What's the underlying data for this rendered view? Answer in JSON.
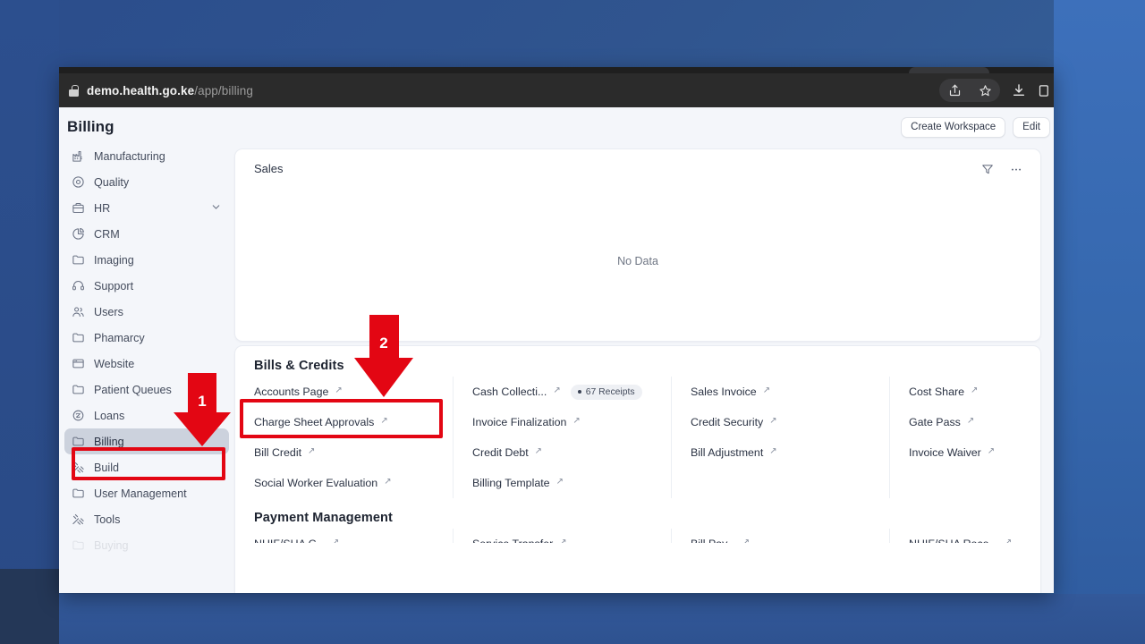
{
  "browser": {
    "url_host": "demo.health.go.ke",
    "url_path": "/app/billing",
    "icons": [
      "lock-icon",
      "share-icon",
      "bookmark-star-icon",
      "download-icon",
      "extensions-icon"
    ]
  },
  "header": {
    "title": "Billing",
    "create_workspace_label": "Create Workspace",
    "edit_label": "Edit"
  },
  "sidebar": {
    "items": [
      {
        "label": "Manufacturing",
        "icon": "factory-icon",
        "active": false,
        "expandable": false
      },
      {
        "label": "Quality",
        "icon": "shield-check-icon",
        "active": false,
        "expandable": false
      },
      {
        "label": "HR",
        "icon": "briefcase-icon",
        "active": false,
        "expandable": true
      },
      {
        "label": "CRM",
        "icon": "pie-chart-icon",
        "active": false,
        "expandable": false
      },
      {
        "label": "Imaging",
        "icon": "folder-icon",
        "active": false,
        "expandable": false
      },
      {
        "label": "Support",
        "icon": "headset-icon",
        "active": false,
        "expandable": false
      },
      {
        "label": "Users",
        "icon": "users-icon",
        "active": false,
        "expandable": false
      },
      {
        "label": "Phamarcy",
        "icon": "folder-icon",
        "active": false,
        "expandable": false
      },
      {
        "label": "Website",
        "icon": "window-icon",
        "active": false,
        "expandable": false
      },
      {
        "label": "Patient Queues",
        "icon": "folder-icon",
        "active": false,
        "expandable": false
      },
      {
        "label": "Loans",
        "icon": "loan-icon",
        "active": false,
        "expandable": false
      },
      {
        "label": "Billing",
        "icon": "folder-icon",
        "active": true,
        "expandable": false
      },
      {
        "label": "Build",
        "icon": "tools-icon",
        "active": false,
        "expandable": false
      },
      {
        "label": "User Management",
        "icon": "folder-icon",
        "active": false,
        "expandable": false
      },
      {
        "label": "Tools",
        "icon": "tools-icon",
        "active": false,
        "expandable": false
      },
      {
        "label": "Buying",
        "icon": "folder-icon",
        "active": false,
        "expandable": false
      }
    ]
  },
  "sales_card": {
    "title": "Sales",
    "filter_icon": "filter-funnel-icon",
    "more_icon": "ellipsis-icon",
    "empty_text": "No Data"
  },
  "bills_section": {
    "title": "Bills & Credits",
    "rows": [
      [
        {
          "label": "Accounts Page",
          "badge": null
        },
        {
          "label": "Cash Collecti...",
          "badge": "67 Receipts"
        },
        {
          "label": "Sales Invoice",
          "badge": null
        },
        {
          "label": "Cost Share",
          "badge": null
        }
      ],
      [
        {
          "label": "Charge Sheet Approvals",
          "badge": null
        },
        {
          "label": "Invoice Finalization",
          "badge": null
        },
        {
          "label": "Credit Security",
          "badge": null
        },
        {
          "label": "Gate Pass",
          "badge": null
        }
      ],
      [
        {
          "label": "Bill Credit",
          "badge": null
        },
        {
          "label": "Credit Debt",
          "badge": null
        },
        {
          "label": "Bill Adjustment",
          "badge": null
        },
        {
          "label": "Invoice Waiver",
          "badge": null
        }
      ],
      [
        {
          "label": "Social Worker Evaluation",
          "badge": null
        },
        {
          "label": "Billing Template",
          "badge": null
        },
        {
          "label": "",
          "badge": null
        },
        {
          "label": "",
          "badge": null
        }
      ]
    ]
  },
  "payment_section": {
    "title": "Payment Management",
    "rows": [
      [
        {
          "label": "NHIF/SHA C...",
          "badge": null
        },
        {
          "label": "Service Transfer",
          "badge": null
        },
        {
          "label": "Bill Pay...",
          "badge": null
        },
        {
          "label": "NHIF/SHA Rece...",
          "badge": null
        }
      ]
    ]
  },
  "annotations": {
    "markers": [
      {
        "number": "1",
        "target": "sidebar-item-billing"
      },
      {
        "number": "2",
        "target": "link-accounts-page"
      }
    ],
    "color": "#e30613"
  }
}
